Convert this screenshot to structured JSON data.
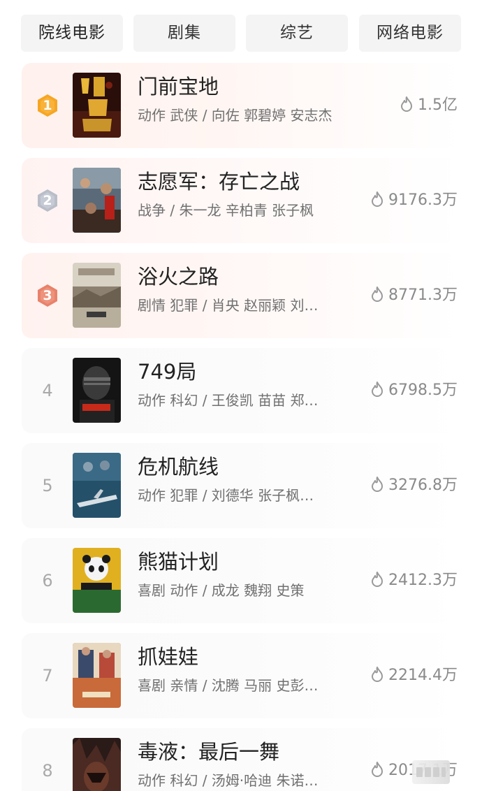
{
  "tabs": [
    {
      "label": "院线电影",
      "active": true
    },
    {
      "label": "剧集",
      "active": false
    },
    {
      "label": "综艺",
      "active": false
    },
    {
      "label": "网络电影",
      "active": false
    }
  ],
  "ranking": [
    {
      "rank": "1",
      "title": "门前宝地",
      "meta": "动作 武侠 / 向佐 郭碧婷 安志杰",
      "heat": "1.5亿",
      "badge": "gold"
    },
    {
      "rank": "2",
      "title": "志愿军：存亡之战",
      "meta": "战争 / 朱一龙 辛柏青 张子枫",
      "heat": "9176.3万",
      "badge": "silver"
    },
    {
      "rank": "3",
      "title": "浴火之路",
      "meta": "剧情 犯罪 / 肖央 赵丽颖 刘…",
      "heat": "8771.3万",
      "badge": "bronze"
    },
    {
      "rank": "4",
      "title": "749局",
      "meta": "动作 科幻 / 王俊凯 苗苗 郑…",
      "heat": "6798.5万",
      "badge": "none"
    },
    {
      "rank": "5",
      "title": "危机航线",
      "meta": "动作 犯罪 / 刘德华 张子枫…",
      "heat": "3276.8万",
      "badge": "none"
    },
    {
      "rank": "6",
      "title": "熊猫计划",
      "meta": "喜剧 动作 / 成龙 魏翔 史策",
      "heat": "2412.3万",
      "badge": "none"
    },
    {
      "rank": "7",
      "title": "抓娃娃",
      "meta": "喜剧 亲情 / 沈腾 马丽 史彭…",
      "heat": "2214.4万",
      "badge": "none"
    },
    {
      "rank": "8",
      "title": "毒液：最后一舞",
      "meta": "动作 科幻 / 汤姆·哈迪 朱诺…",
      "heat": "2017.1万",
      "badge": "none"
    }
  ],
  "icons": {
    "heat": "flame-outline-icon"
  },
  "colors": {
    "gold": "#f6a623",
    "silver": "#b9bdc8",
    "bronze": "#e8826b",
    "text_primary": "#222222",
    "text_secondary": "#707070",
    "heat_text": "#8a8a8a"
  }
}
